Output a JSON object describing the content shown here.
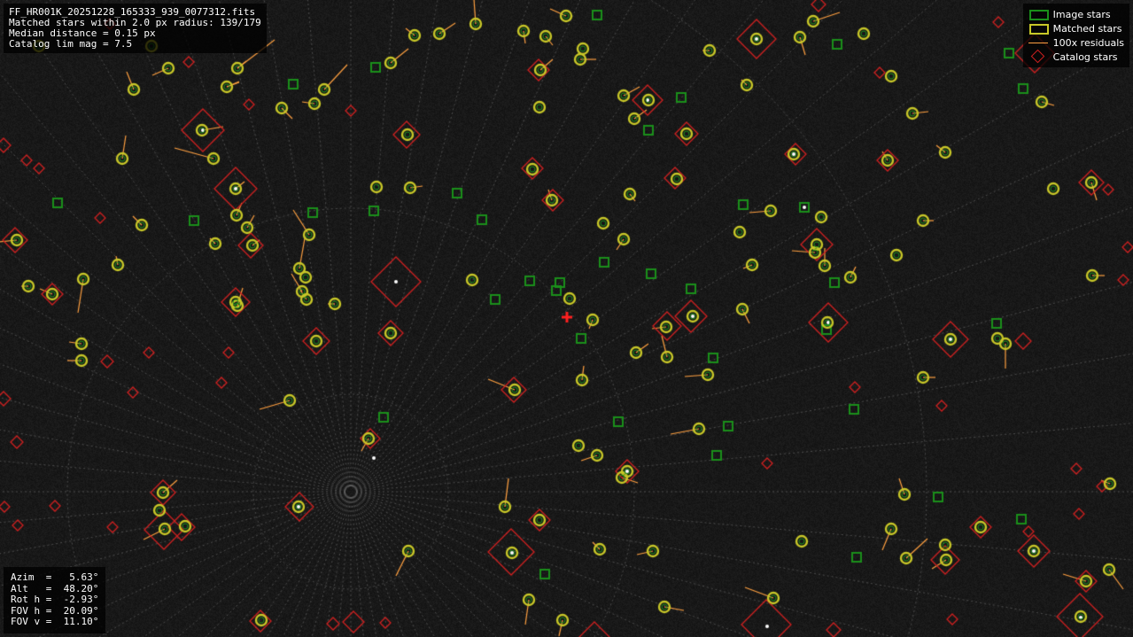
{
  "info": {
    "filename": "FF_HR001K_20251228_165333_939_0077312.fits",
    "matched": "Matched stars within 2.0 px radius: 139/179",
    "median": "Median distance = 0.15 px",
    "catalog": "Catalog lim mag = 7.5"
  },
  "legend": {
    "image_stars": "Image stars",
    "matched_stars": "Matched stars",
    "residuals": "100x residuals",
    "catalog_stars": "Catalog stars"
  },
  "coords": {
    "azim": "Azim  =   5.63°",
    "alt": "Alt   =  48.20°",
    "rot": "Rot h =  -2.93°",
    "fovh": "FOV h =  20.09°",
    "fovv": "FOV v =  11.10°"
  },
  "colors": {
    "image_star": "#1a8f1a",
    "matched_star": "#c8c828",
    "residual": "#ffa040",
    "catalog_star": "#d02020",
    "center_marker": "#ff2020",
    "grid": "#8a8a8a"
  }
}
